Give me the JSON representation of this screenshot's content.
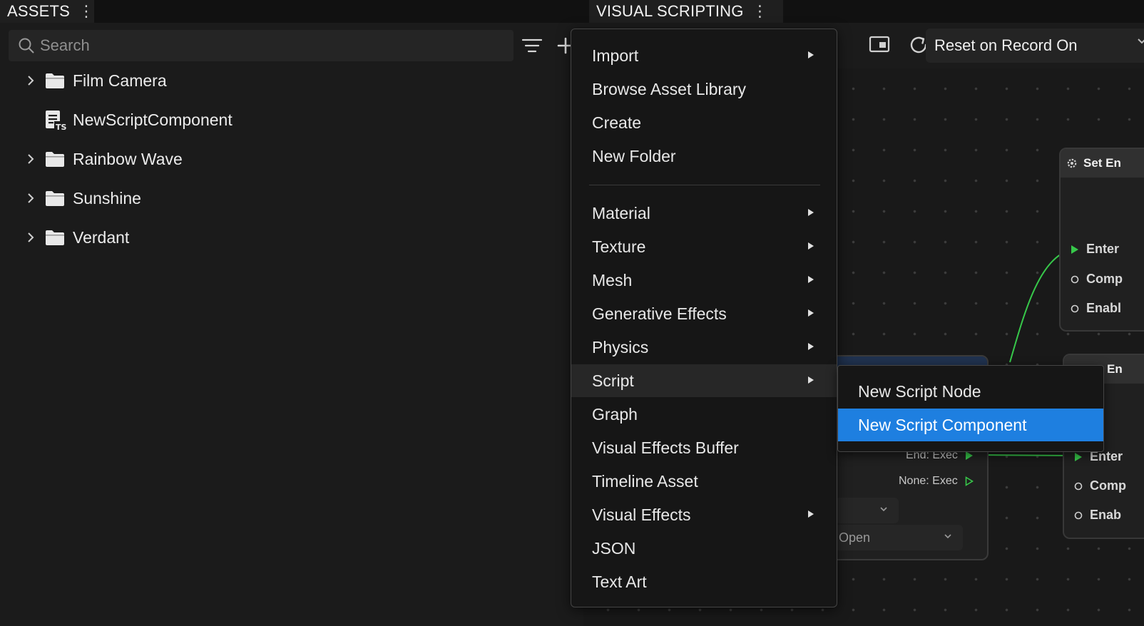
{
  "tabs": {
    "assets": "ASSETS",
    "visual_scripting": "VISUAL SCRIPTING"
  },
  "assets": {
    "search_placeholder": "Search",
    "items": [
      {
        "label": "Film Camera",
        "type": "folder"
      },
      {
        "label": "NewScriptComponent",
        "type": "script"
      },
      {
        "label": "Rainbow Wave",
        "type": "folder"
      },
      {
        "label": "Sunshine",
        "type": "folder"
      },
      {
        "label": "Verdant",
        "type": "folder"
      }
    ]
  },
  "vs_toolbar": {
    "reset_option": "Reset on Record On"
  },
  "nodes": {
    "set_node": {
      "header": "Set En",
      "pins": [
        "Enter",
        "Comp",
        "Enabl"
      ]
    },
    "second_node": {
      "header": "En",
      "pins": [
        "Enter",
        "Comp",
        "Enab"
      ]
    },
    "left_node": {
      "exec_outputs": [
        "End: Exec",
        "None: Exec"
      ],
      "select_value": "Open"
    }
  },
  "context_menu": {
    "items": [
      {
        "label": "Import",
        "submenu": true
      },
      {
        "label": "Browse Asset Library",
        "submenu": false
      },
      {
        "label": "Create",
        "submenu": false
      },
      {
        "label": "New Folder",
        "submenu": false
      },
      {
        "label": "Material",
        "submenu": true
      },
      {
        "label": "Texture",
        "submenu": true
      },
      {
        "label": "Mesh",
        "submenu": true
      },
      {
        "label": "Generative Effects",
        "submenu": true
      },
      {
        "label": "Physics",
        "submenu": true
      },
      {
        "label": "Script",
        "submenu": true,
        "highlighted": true
      },
      {
        "label": "Graph",
        "submenu": false
      },
      {
        "label": "Visual Effects Buffer",
        "submenu": false
      },
      {
        "label": "Timeline Asset",
        "submenu": false
      },
      {
        "label": "Visual Effects",
        "submenu": true
      },
      {
        "label": "JSON",
        "submenu": false
      },
      {
        "label": "Text Art",
        "submenu": false
      }
    ],
    "script_submenu": [
      {
        "label": "New Script Node"
      },
      {
        "label": "New Script Component",
        "active": true
      }
    ]
  },
  "colors": {
    "accent": "#1e7fe0",
    "exec_pin": "#37c84a",
    "panel_bg": "#1b1b1b",
    "menu_bg": "#161616"
  }
}
